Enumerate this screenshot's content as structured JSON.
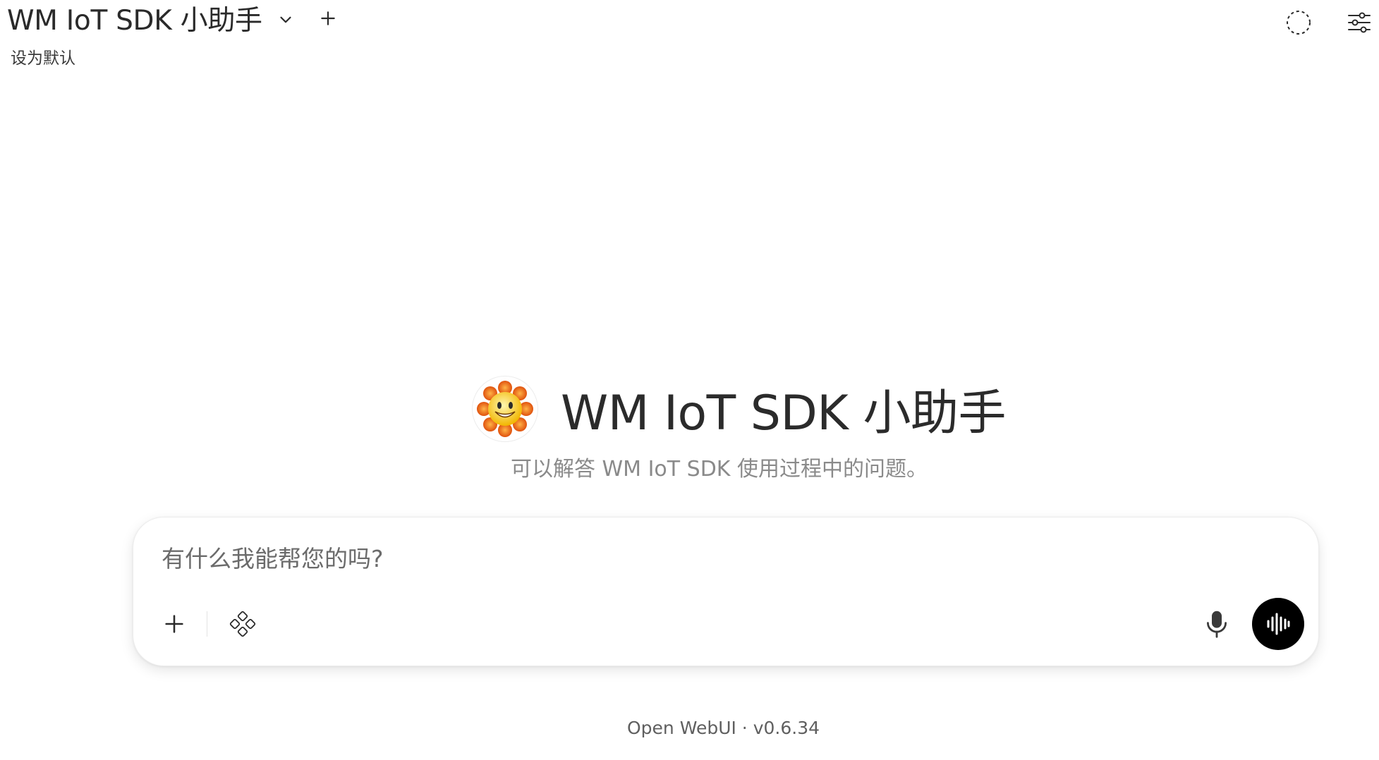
{
  "header": {
    "model_name": "WM IoT SDK 小助手",
    "set_default_label": "设为默认",
    "icons": {
      "model_dropdown": "chevron-down-icon",
      "add_model": "plus-icon",
      "temporary_chat": "dashed-circle-icon",
      "controls": "sliders-icon"
    }
  },
  "hero": {
    "title": "WM IoT SDK 小助手",
    "subtitle": "可以解答 WM IoT SDK 使用过程中的问题。",
    "avatar_icon": "sun-smiley-icon"
  },
  "composer": {
    "placeholder": "有什么我能帮您的吗?",
    "value": "",
    "icons": {
      "attach": "plus-icon",
      "tools": "integrations-icon",
      "dictate": "microphone-icon",
      "voice_mode": "waveform-icon"
    },
    "colors": {
      "voice_button_bg": "#000000"
    }
  },
  "footer": {
    "version_text": "Open WebUI · v0.6.34"
  }
}
